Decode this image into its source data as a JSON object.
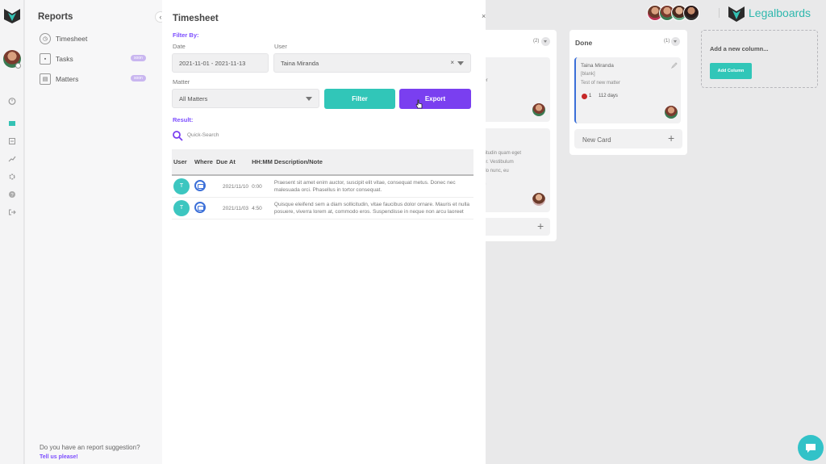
{
  "rail": {
    "icons": [
      "logo-icon",
      "timer-icon",
      "board-icon",
      "tasks-icon",
      "reports-icon",
      "settings-icon",
      "help-icon",
      "logout-icon"
    ]
  },
  "reports": {
    "title": "Reports",
    "items": [
      {
        "label": "Timesheet",
        "icon": "clock-icon"
      },
      {
        "label": "Tasks",
        "icon": "tasks-icon",
        "badge": "soon"
      },
      {
        "label": "Matters",
        "icon": "matters-icon",
        "badge": "soon"
      }
    ],
    "suggestion": "Do you have an report suggestion?",
    "tell_us": "Tell us please!"
  },
  "timesheet": {
    "title": "Timesheet",
    "filter_by": "Filter By:",
    "date_label": "Date",
    "date_value": "2021-11-01 - 2021-11-13",
    "user_label": "User",
    "user_value": "Taina Miranda",
    "clear_icon": "×",
    "matter_label": "Matter",
    "matter_value": "All Matters",
    "filter_button": "Filter",
    "export_button": "Export",
    "result_label": "Result:",
    "search_placeholder": "Quick-Search",
    "columns": [
      "User",
      "Where",
      "Due At",
      "HH:MM",
      "Description/Note"
    ],
    "rows": [
      {
        "user": "T",
        "due": "2021/11/10",
        "hhmm": "0:00",
        "desc": "Praesent sit amet enim auctor, suscipit elit vitae, consequat metus. Donec nec malesuada orci. Phasellus in tortor consequat."
      },
      {
        "user": "T",
        "due": "2021/11/03",
        "hhmm": "4:50",
        "desc": "Quisque eleifend sem a diam sollicitudin, vitae faucibus dolor ornare. Mauris et nulla posuere, viverra lorem at, commodo eros. Suspendisse in neque non arcu laoreet"
      }
    ]
  },
  "board": {
    "partial_col": {
      "count": "(2)",
      "card1_lines": [
        "tter",
        "s"
      ],
      "card2_lines": [
        "e",
        "licitudin quam eget",
        "itur. Vestibulum",
        "odo nunc, eu",
        "ds"
      ]
    },
    "done": {
      "title": "Done",
      "count": "(1)",
      "card": {
        "name": "Taina Miranda",
        "tag": "[blank]",
        "desc": "Test of new matter",
        "alert": "1",
        "days": "112 days"
      },
      "new_card": "New Card"
    },
    "add_column": {
      "title": "Add a new column...",
      "button": "Add Column"
    },
    "brand": "Legalboards"
  },
  "colors": {
    "teal": "#31c6b8",
    "purple": "#7a3ff0",
    "accent_text": "#7c4dff"
  }
}
